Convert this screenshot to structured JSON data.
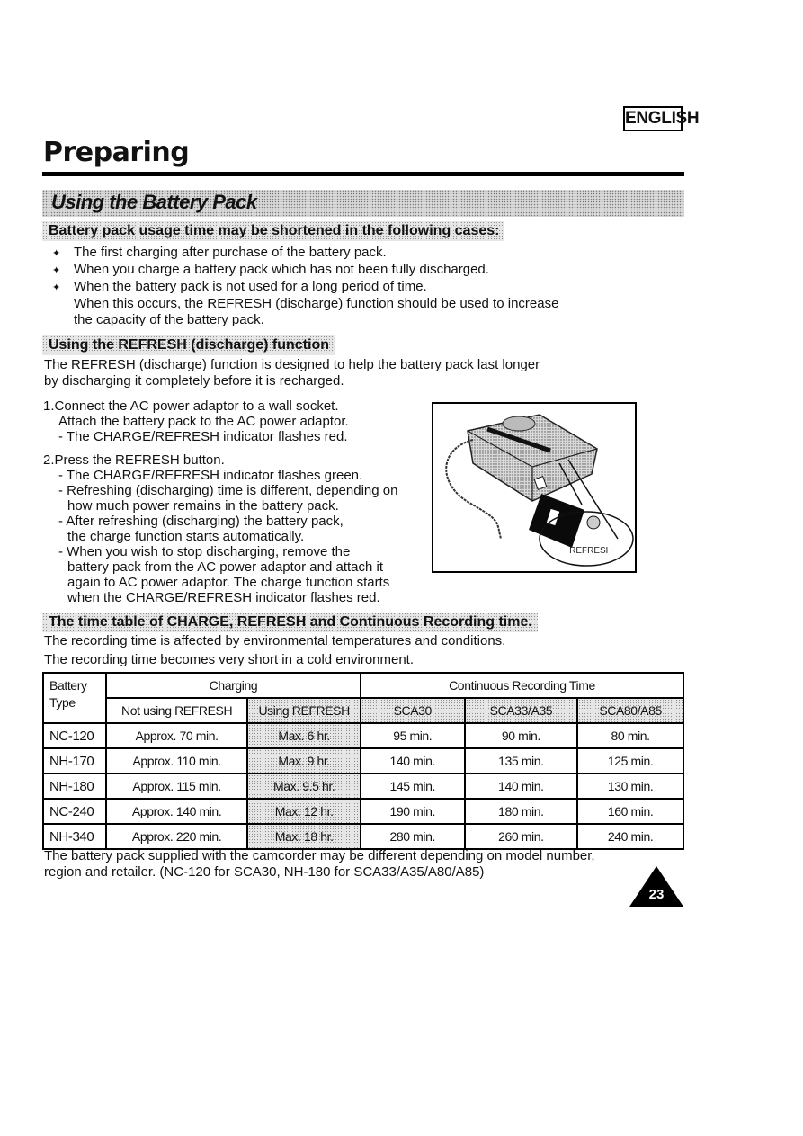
{
  "header": {
    "language_badge": "ENGLISH",
    "page_title": "Preparing"
  },
  "section": {
    "title": "Using the Battery Pack"
  },
  "usage": {
    "heading": "Battery pack usage time may be shortened in the following cases:",
    "bullet_icon": "diamond-cross-bullet-icon",
    "bullets": [
      "The first charging after purchase of the battery pack.",
      "When you charge a battery pack which has not been fully discharged.",
      "When the battery pack is not used for a long period of time."
    ],
    "continuation": [
      "When this occurs, the REFRESH (discharge) function should be used to increase",
      "the capacity of the battery pack."
    ]
  },
  "refresh": {
    "heading": "Using the REFRESH (discharge) function",
    "intro": [
      "The REFRESH (discharge) function is designed to help the battery pack last longer",
      "by discharging it completely before it is recharged."
    ],
    "steps": [
      {
        "lines": [
          "1.Connect the AC power adaptor to a wall socket.",
          "Attach the battery pack to the AC power adaptor.",
          "- The CHARGE/REFRESH indicator flashes red."
        ]
      },
      {
        "lines": [
          "2.Press the REFRESH button.",
          "- The CHARGE/REFRESH indicator flashes green.",
          "- Refreshing (discharging) time is different, depending on",
          "how much power remains in the battery pack.",
          "- After refreshing (discharging) the battery pack,",
          "the charge function starts automatically.",
          "- When you wish to stop discharging, remove the",
          "battery pack from the AC power adaptor and attach it",
          "again to AC power adaptor. The charge function starts",
          "when the CHARGE/REFRESH indicator flashes red."
        ]
      }
    ],
    "figure_label": "REFRESH"
  },
  "timetable": {
    "heading": "The time table of CHARGE, REFRESH and Continuous Recording time.",
    "notes": [
      "The recording time is affected by environmental temperatures and conditions.",
      "The recording time becomes very short in a cold environment."
    ],
    "header_battery_type": [
      "Battery",
      "Type"
    ],
    "header_charging": "Charging",
    "header_recording": "Continuous Recording Time",
    "subheaders": [
      "Not using REFRESH",
      "Using REFRESH",
      "SCA30",
      "SCA33/A35",
      "SCA80/A85"
    ],
    "rows": [
      {
        "type": "NC-120",
        "not_refresh": "Approx. 70 min.",
        "refresh": "Max. 6 hr.",
        "sca30": "95 min.",
        "sca33": "90 min.",
        "sca80": "80 min."
      },
      {
        "type": "NH-170",
        "not_refresh": "Approx. 110 min.",
        "refresh": "Max. 9 hr.",
        "sca30": "140 min.",
        "sca33": "135 min.",
        "sca80": "125 min."
      },
      {
        "type": "NH-180",
        "not_refresh": "Approx. 115 min.",
        "refresh": "Max. 9.5 hr.",
        "sca30": "145 min.",
        "sca33": "140 min.",
        "sca80": "130 min."
      },
      {
        "type": "NC-240",
        "not_refresh": "Approx. 140 min.",
        "refresh": "Max. 12 hr.",
        "sca30": "190 min.",
        "sca33": "180 min.",
        "sca80": "160 min."
      },
      {
        "type": "NH-340",
        "not_refresh": "Approx. 220 min.",
        "refresh": "Max. 18 hr.",
        "sca30": "280 min.",
        "sca33": "260 min.",
        "sca80": "240 min."
      }
    ]
  },
  "footnote": [
    "The battery pack supplied with the camcorder may be different depending on model number,",
    "region and retailer. (NC-120 for SCA30, NH-180 for SCA33/A35/A80/A85)"
  ],
  "page_number": "23"
}
